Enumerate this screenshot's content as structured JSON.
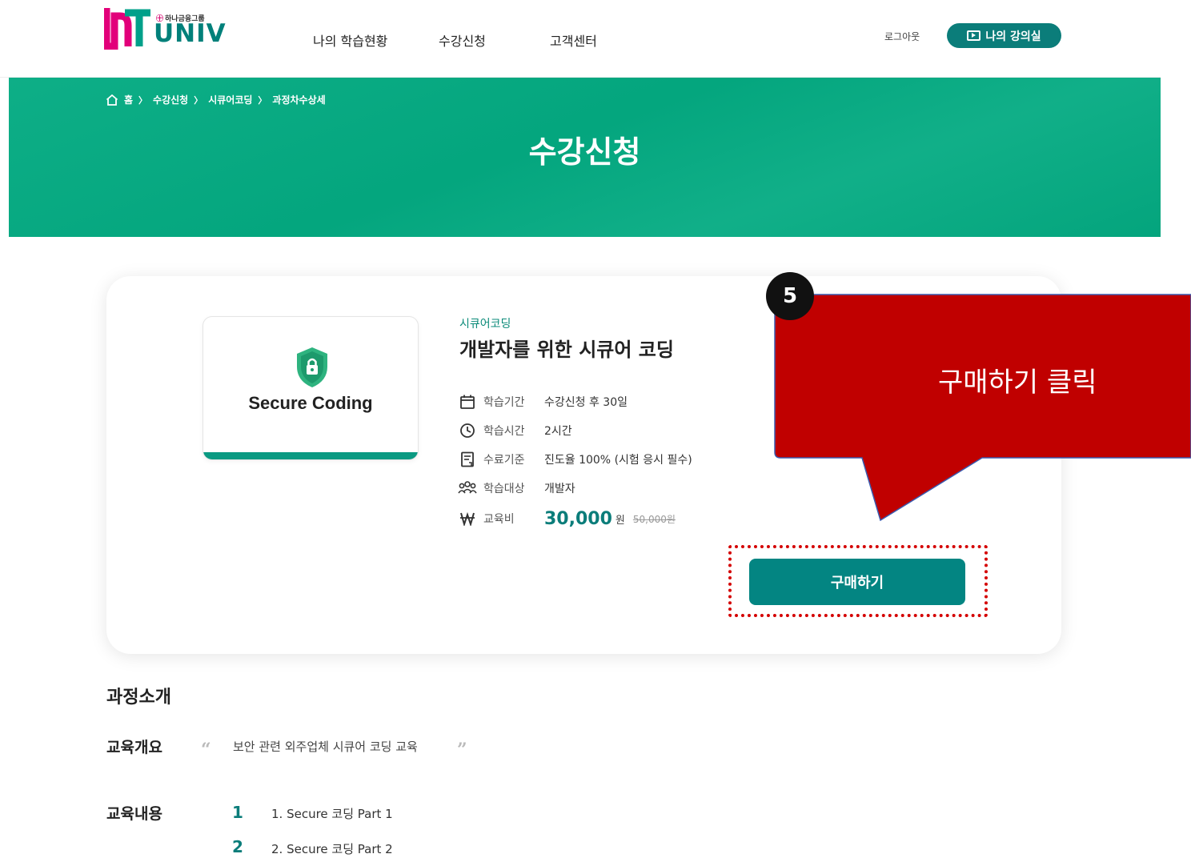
{
  "header": {
    "logo_sub": "하나금융그룹",
    "logo_main": "UNIV",
    "nav": [
      "나의 학습현황",
      "수강신청",
      "고객센터"
    ],
    "logout": "로그아웃",
    "my_lecture_room": "나의 강의실"
  },
  "banner": {
    "breadcrumb": [
      "홈",
      "수강신청",
      "시큐어코딩",
      "과정차수상세"
    ],
    "title": "수강신청"
  },
  "course": {
    "thumbnail_text": "Secure Coding",
    "category": "시큐어코딩",
    "title": "개발자를 위한 시큐어 코딩",
    "info": [
      {
        "icon": "calendar-icon",
        "label": "학습기간",
        "value": "수강신청 후 30일"
      },
      {
        "icon": "clock-icon",
        "label": "학습시간",
        "value": "2시간"
      },
      {
        "icon": "certificate-icon",
        "label": "수료기준",
        "value": "진도율 100% (시험 응시 필수)"
      },
      {
        "icon": "people-icon",
        "label": "학습대상",
        "value": "개발자"
      }
    ],
    "fee": {
      "icon": "won-icon",
      "label": "교육비",
      "price": "30,000",
      "unit": "원",
      "original": "50,000원"
    },
    "buy_button": "구매하기"
  },
  "annotation": {
    "step": "5",
    "callout": "구매하기 클릭",
    "callout_color": "#c00000"
  },
  "intro": {
    "title": "과정소개",
    "overview_label": "교육개요",
    "overview_text": "보안 관련 외주업체 시큐어 코딩 교육",
    "content_label": "교육내용",
    "contents": [
      {
        "num": "1",
        "text": "1. Secure 코딩 Part 1"
      },
      {
        "num": "2",
        "text": "2. Secure 코딩 Part 2"
      }
    ]
  },
  "colors": {
    "brand": "#0b7d7a",
    "banner": "#04ab82"
  }
}
